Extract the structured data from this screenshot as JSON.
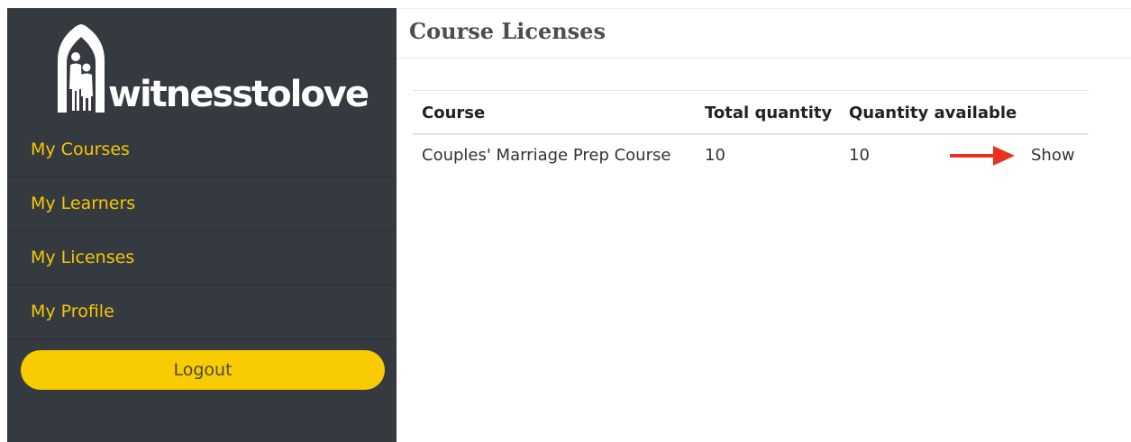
{
  "brand": {
    "logo_text": "witnesstolove"
  },
  "sidebar": {
    "items": [
      {
        "label": "My Courses"
      },
      {
        "label": "My Learners"
      },
      {
        "label": "My Licenses"
      },
      {
        "label": "My Profile"
      }
    ],
    "logout_label": "Logout"
  },
  "main": {
    "title": "Course Licenses",
    "table": {
      "headers": [
        "Course",
        "Total quantity",
        "Quantity available"
      ],
      "rows": [
        {
          "course": "Couples' Marriage Prep Course",
          "total": "10",
          "available": "10",
          "action": "Show"
        }
      ]
    }
  },
  "colors": {
    "sidebar_bg": "#353a40",
    "nav_text": "#f5c800",
    "button_bg": "#f8cc00",
    "annotation_arrow": "#e8321e"
  },
  "icons": {
    "logo": "church-arch-couple-icon",
    "annotation": "red-arrow-icon"
  }
}
